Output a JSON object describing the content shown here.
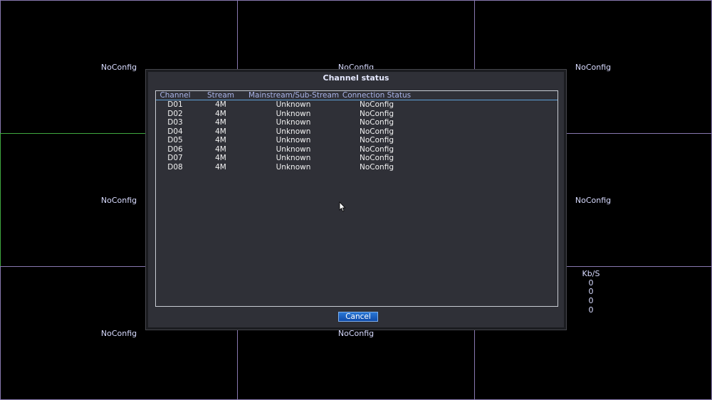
{
  "grid": {
    "tiles": [
      {
        "label": "NoConfig"
      },
      {
        "label": "NoConfig"
      },
      {
        "label": "NoConfig"
      },
      {
        "label": "NoConfig"
      },
      {
        "label": ""
      },
      {
        "label": "NoConfig"
      },
      {
        "label": "NoConfig"
      },
      {
        "label": "NoConfig"
      },
      {
        "label": ""
      }
    ]
  },
  "bitrate": {
    "header": "Kb/S",
    "values": [
      "0",
      "0",
      "0",
      "0"
    ]
  },
  "dialog": {
    "title": "Channel status",
    "columns": {
      "channel": "Channel",
      "stream": "Stream",
      "stream_type": "Mainstream/Sub-Stream",
      "connection": "Connection Status"
    },
    "rows": [
      {
        "channel": "D01",
        "stream": "4M",
        "stream_type": "Unknown",
        "connection": "NoConfig"
      },
      {
        "channel": "D02",
        "stream": "4M",
        "stream_type": "Unknown",
        "connection": "NoConfig"
      },
      {
        "channel": "D03",
        "stream": "4M",
        "stream_type": "Unknown",
        "connection": "NoConfig"
      },
      {
        "channel": "D04",
        "stream": "4M",
        "stream_type": "Unknown",
        "connection": "NoConfig"
      },
      {
        "channel": "D05",
        "stream": "4M",
        "stream_type": "Unknown",
        "connection": "NoConfig"
      },
      {
        "channel": "D06",
        "stream": "4M",
        "stream_type": "Unknown",
        "connection": "NoConfig"
      },
      {
        "channel": "D07",
        "stream": "4M",
        "stream_type": "Unknown",
        "connection": "NoConfig"
      },
      {
        "channel": "D08",
        "stream": "4M",
        "stream_type": "Unknown",
        "connection": "NoConfig"
      }
    ],
    "cancel_label": "Cancel"
  },
  "colors": {
    "grid_border": "#8878b0",
    "selected_border": "#3fa83f",
    "dialog_bg": "#2f3037",
    "button_blue": "#1560c4"
  }
}
